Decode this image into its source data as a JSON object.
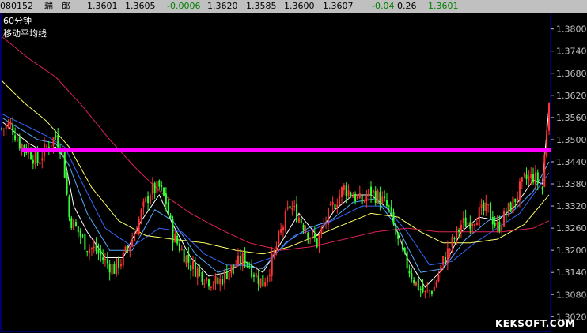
{
  "quote_bar": {
    "code": "080152",
    "name": "瑞　郎",
    "fields": [
      {
        "text": "1.3601",
        "color": "black"
      },
      {
        "text": "1.3605",
        "color": "black"
      },
      {
        "text": "-0.0006",
        "color": "green"
      },
      {
        "text": "1.3620",
        "color": "black"
      },
      {
        "text": "1.3585",
        "color": "black"
      },
      {
        "text": "1.3600",
        "color": "black"
      },
      {
        "text": "1.3607",
        "color": "black"
      },
      {
        "text": "-0.04",
        "color": "green"
      },
      {
        "text": "0.26",
        "color": "black"
      },
      {
        "text": "1.3601",
        "color": "green"
      }
    ]
  },
  "legend": {
    "period": "60分钟",
    "indicator": "移动平均线"
  },
  "watermark": "KEKSOFT.COM",
  "colors": {
    "background": "#000000",
    "frame": "#0000cc",
    "candle_up": "#ff3333",
    "candle_down": "#33ff33",
    "candle_flat": "#ffff00",
    "ma_fast": "#ffffff",
    "ma_mid1": "#55aaff",
    "ma_mid2": "#3366ff",
    "ma_slow": "#ffff66",
    "ma_longest": "#dd2255",
    "support_line": "#ff00ff"
  },
  "chart_data": {
    "type": "candlestick",
    "period": "60分钟",
    "ylim": [
      1.298,
      1.384
    ],
    "yticks": [
      "1.3800",
      "1.3740",
      "1.3680",
      "1.3620",
      "1.3560",
      "1.3500",
      "1.3440",
      "1.3380",
      "1.3320",
      "1.3260",
      "1.3200",
      "1.3140",
      "1.3080",
      "1.3020",
      "1.2960"
    ],
    "grid": false,
    "horizontal_line": 1.3472,
    "close_path": [
      [
        0,
        1.353
      ],
      [
        4,
        1.354
      ],
      [
        8,
        1.349
      ],
      [
        12,
        1.347
      ],
      [
        16,
        1.344
      ],
      [
        20,
        1.348
      ],
      [
        24,
        1.351
      ],
      [
        27,
        1.347
      ],
      [
        30,
        1.329
      ],
      [
        34,
        1.325
      ],
      [
        38,
        1.321
      ],
      [
        42,
        1.32
      ],
      [
        46,
        1.317
      ],
      [
        50,
        1.315
      ],
      [
        54,
        1.318
      ],
      [
        58,
        1.323
      ],
      [
        62,
        1.33
      ],
      [
        66,
        1.336
      ],
      [
        70,
        1.337
      ],
      [
        73,
        1.333
      ],
      [
        76,
        1.324
      ],
      [
        80,
        1.32
      ],
      [
        84,
        1.316
      ],
      [
        88,
        1.314
      ],
      [
        92,
        1.312
      ],
      [
        96,
        1.311
      ],
      [
        100,
        1.314
      ],
      [
        104,
        1.316
      ],
      [
        108,
        1.318
      ],
      [
        112,
        1.314
      ],
      [
        116,
        1.311
      ],
      [
        120,
        1.317
      ],
      [
        124,
        1.325
      ],
      [
        128,
        1.332
      ],
      [
        132,
        1.329
      ],
      [
        136,
        1.325
      ],
      [
        140,
        1.322
      ],
      [
        144,
        1.328
      ],
      [
        148,
        1.333
      ],
      [
        152,
        1.337
      ],
      [
        156,
        1.335
      ],
      [
        160,
        1.333
      ],
      [
        164,
        1.336
      ],
      [
        168,
        1.334
      ],
      [
        172,
        1.331
      ],
      [
        176,
        1.322
      ],
      [
        180,
        1.316
      ],
      [
        184,
        1.311
      ],
      [
        188,
        1.308
      ],
      [
        192,
        1.31
      ],
      [
        196,
        1.317
      ],
      [
        200,
        1.322
      ],
      [
        204,
        1.327
      ],
      [
        208,
        1.328
      ],
      [
        212,
        1.33
      ],
      [
        216,
        1.331
      ],
      [
        220,
        1.326
      ],
      [
        224,
        1.33
      ],
      [
        228,
        1.334
      ],
      [
        232,
        1.339
      ],
      [
        236,
        1.34
      ],
      [
        240,
        1.337
      ],
      [
        243,
        1.362
      ]
    ],
    "series": [
      {
        "name": "MA1",
        "color_key": "ma_fast",
        "points": [
          [
            0,
            1.355
          ],
          [
            6,
            1.352
          ],
          [
            12,
            1.349
          ],
          [
            18,
            1.347
          ],
          [
            24,
            1.348
          ],
          [
            28,
            1.345
          ],
          [
            32,
            1.332
          ],
          [
            38,
            1.325
          ],
          [
            46,
            1.318
          ],
          [
            54,
            1.318
          ],
          [
            62,
            1.328
          ],
          [
            70,
            1.335
          ],
          [
            76,
            1.327
          ],
          [
            84,
            1.318
          ],
          [
            92,
            1.313
          ],
          [
            100,
            1.314
          ],
          [
            108,
            1.317
          ],
          [
            116,
            1.314
          ],
          [
            124,
            1.322
          ],
          [
            132,
            1.33
          ],
          [
            140,
            1.324
          ],
          [
            148,
            1.331
          ],
          [
            156,
            1.335
          ],
          [
            164,
            1.335
          ],
          [
            172,
            1.331
          ],
          [
            180,
            1.318
          ],
          [
            188,
            1.31
          ],
          [
            196,
            1.315
          ],
          [
            204,
            1.325
          ],
          [
            212,
            1.329
          ],
          [
            220,
            1.328
          ],
          [
            228,
            1.332
          ],
          [
            236,
            1.339
          ],
          [
            240,
            1.338
          ],
          [
            243,
            1.359
          ]
        ]
      },
      {
        "name": "MA2",
        "color_key": "ma_mid1",
        "points": [
          [
            0,
            1.356
          ],
          [
            8,
            1.353
          ],
          [
            16,
            1.35
          ],
          [
            24,
            1.349
          ],
          [
            30,
            1.343
          ],
          [
            38,
            1.33
          ],
          [
            48,
            1.32
          ],
          [
            58,
            1.32
          ],
          [
            68,
            1.331
          ],
          [
            76,
            1.328
          ],
          [
            86,
            1.319
          ],
          [
            96,
            1.314
          ],
          [
            106,
            1.316
          ],
          [
            116,
            1.315
          ],
          [
            126,
            1.322
          ],
          [
            136,
            1.326
          ],
          [
            146,
            1.328
          ],
          [
            156,
            1.333
          ],
          [
            166,
            1.334
          ],
          [
            176,
            1.326
          ],
          [
            186,
            1.314
          ],
          [
            196,
            1.315
          ],
          [
            206,
            1.323
          ],
          [
            216,
            1.328
          ],
          [
            226,
            1.33
          ],
          [
            236,
            1.336
          ],
          [
            243,
            1.344
          ]
        ]
      },
      {
        "name": "MA3",
        "color_key": "ma_mid2",
        "points": [
          [
            0,
            1.357
          ],
          [
            10,
            1.354
          ],
          [
            20,
            1.351
          ],
          [
            28,
            1.348
          ],
          [
            36,
            1.338
          ],
          [
            46,
            1.326
          ],
          [
            58,
            1.321
          ],
          [
            70,
            1.326
          ],
          [
            80,
            1.325
          ],
          [
            90,
            1.319
          ],
          [
            100,
            1.316
          ],
          [
            110,
            1.316
          ],
          [
            120,
            1.318
          ],
          [
            130,
            1.324
          ],
          [
            140,
            1.326
          ],
          [
            150,
            1.329
          ],
          [
            160,
            1.332
          ],
          [
            170,
            1.332
          ],
          [
            180,
            1.325
          ],
          [
            190,
            1.316
          ],
          [
            200,
            1.317
          ],
          [
            210,
            1.322
          ],
          [
            220,
            1.326
          ],
          [
            230,
            1.33
          ],
          [
            243,
            1.341
          ]
        ]
      },
      {
        "name": "MA4",
        "color_key": "ma_slow",
        "points": [
          [
            0,
            1.366
          ],
          [
            10,
            1.36
          ],
          [
            20,
            1.355
          ],
          [
            30,
            1.348
          ],
          [
            40,
            1.337
          ],
          [
            52,
            1.328
          ],
          [
            64,
            1.324
          ],
          [
            76,
            1.323
          ],
          [
            90,
            1.322
          ],
          [
            104,
            1.32
          ],
          [
            116,
            1.319
          ],
          [
            128,
            1.321
          ],
          [
            140,
            1.324
          ],
          [
            152,
            1.327
          ],
          [
            164,
            1.33
          ],
          [
            176,
            1.329
          ],
          [
            186,
            1.325
          ],
          [
            196,
            1.322
          ],
          [
            208,
            1.322
          ],
          [
            220,
            1.323
          ],
          [
            232,
            1.327
          ],
          [
            243,
            1.335
          ]
        ]
      },
      {
        "name": "MA5",
        "color_key": "ma_longest",
        "points": [
          [
            0,
            1.378
          ],
          [
            12,
            1.372
          ],
          [
            24,
            1.367
          ],
          [
            36,
            1.359
          ],
          [
            48,
            1.35
          ],
          [
            60,
            1.342
          ],
          [
            72,
            1.335
          ],
          [
            84,
            1.33
          ],
          [
            96,
            1.326
          ],
          [
            110,
            1.322
          ],
          [
            124,
            1.32
          ],
          [
            138,
            1.321
          ],
          [
            152,
            1.323
          ],
          [
            166,
            1.325
          ],
          [
            180,
            1.326
          ],
          [
            194,
            1.325
          ],
          [
            208,
            1.325
          ],
          [
            222,
            1.325
          ],
          [
            236,
            1.326
          ],
          [
            243,
            1.328
          ]
        ]
      }
    ]
  }
}
